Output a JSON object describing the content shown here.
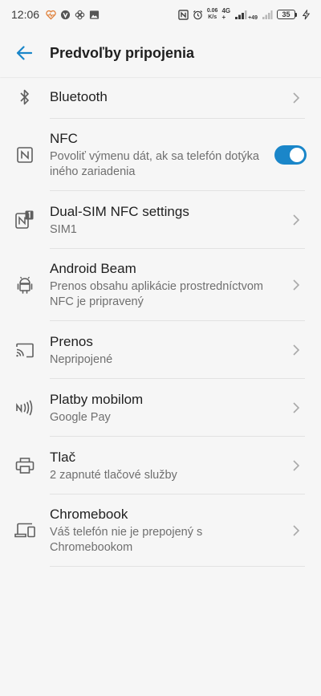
{
  "status_bar": {
    "time": "12:06",
    "net_speed_value": "0.06",
    "net_speed_unit": "K/s",
    "network_type_top": "4G",
    "network_type_bottom": "+",
    "signal_plus": "+49",
    "battery_level": "35",
    "icons": [
      "heart-monitor-icon",
      "vpn-icon",
      "pinwheel-icon",
      "image-icon",
      "nfc-icon",
      "alarm-icon",
      "signal-icon",
      "charging-icon"
    ]
  },
  "app_bar": {
    "title": "Predvoľby pripojenia",
    "back_icon": "arrow-back-icon"
  },
  "items": [
    {
      "key": "bluetooth",
      "icon": "bluetooth-icon",
      "title": "Bluetooth",
      "subtitle": ""
    },
    {
      "key": "nfc",
      "icon": "nfc-icon",
      "title": "NFC",
      "subtitle": "Povoliť výmenu dát, ak sa telefón dotýka iného zariadenia",
      "toggle_on": true
    },
    {
      "key": "dual-sim-nfc",
      "icon": "dual-sim-nfc-icon",
      "title": "Dual-SIM NFC settings",
      "subtitle": "SIM1"
    },
    {
      "key": "android-beam",
      "icon": "android-icon",
      "title": "Android Beam",
      "subtitle": "Prenos obsahu aplikácie prostredníctvom NFC je pripravený"
    },
    {
      "key": "cast",
      "icon": "cast-icon",
      "title": "Prenos",
      "subtitle": "Nepripojené"
    },
    {
      "key": "mobile-payments",
      "icon": "contactless-pay-icon",
      "title": "Platby mobilom",
      "subtitle": "Google Pay"
    },
    {
      "key": "printing",
      "icon": "printer-icon",
      "title": "Tlač",
      "subtitle": "2 zapnuté tlačové služby"
    },
    {
      "key": "chromebook",
      "icon": "devices-icon",
      "title": "Chromebook",
      "subtitle": "Váš telefón nie je prepojený s Chromebookom"
    }
  ],
  "colors": {
    "background": "#f6f6f6",
    "accent": "#1a86c9",
    "title_text": "#1f1f1f",
    "subtitle_text": "#6f6f6f",
    "icon": "#5f5f5f"
  }
}
